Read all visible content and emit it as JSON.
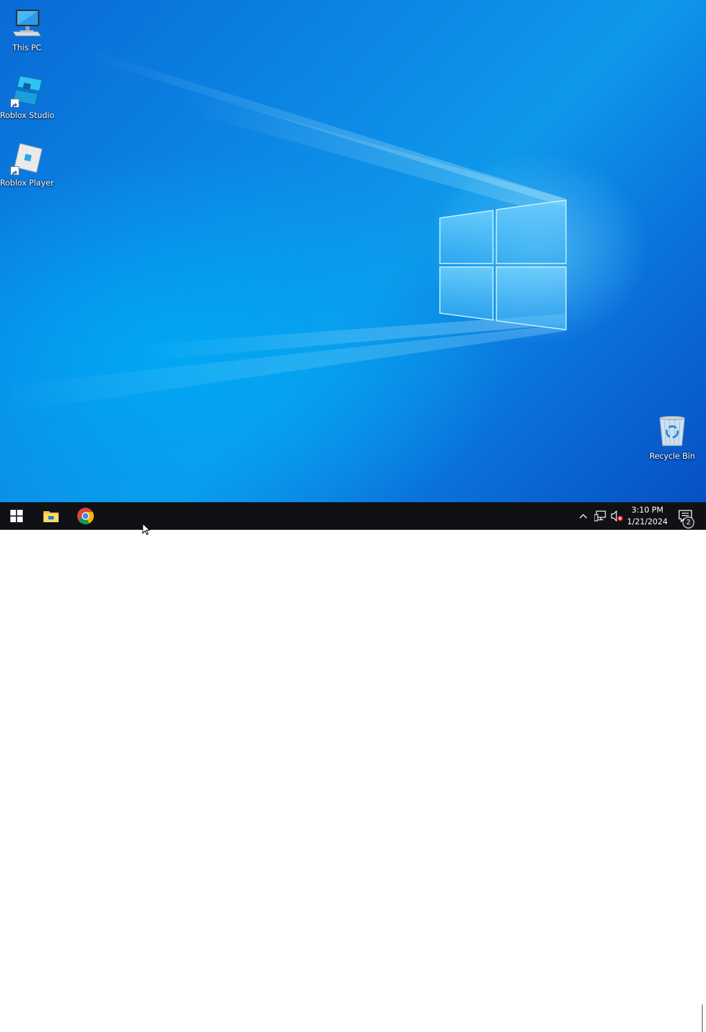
{
  "desktop": {
    "icons": [
      {
        "label": "This PC",
        "icon": "computer-icon"
      },
      {
        "label": "Roblox Studio",
        "icon": "roblox-studio-icon"
      },
      {
        "label": "Roblox Player",
        "icon": "roblox-player-icon"
      },
      {
        "label": "Recycle Bin",
        "icon": "recycle-bin-icon"
      }
    ],
    "wallpaper": {
      "accent": "#0a84e3",
      "logo_glow": "#8fe4ff"
    }
  },
  "taskbar": {
    "background": "#0f1114",
    "start_icon": "windows-start-icon",
    "pinned": [
      {
        "icon": "file-explorer-icon"
      },
      {
        "icon": "chrome-icon"
      }
    ],
    "tray": {
      "overflow_icon": "chevron-up-icon",
      "network_icon": "network-icon",
      "volume_icon": "volume-muted-icon"
    },
    "clock": {
      "time": "3:10 PM",
      "date": "1/21/2024"
    },
    "notifications": {
      "icon": "action-center-icon",
      "count": "2"
    }
  }
}
